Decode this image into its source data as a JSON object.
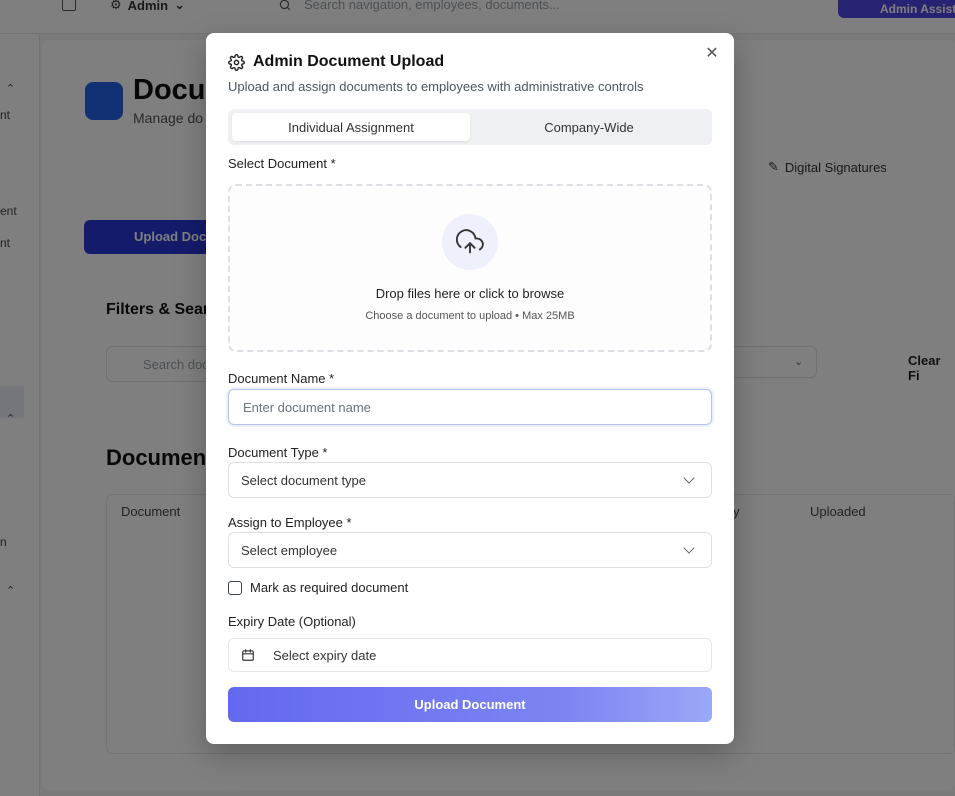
{
  "topbar": {
    "role": "Admin",
    "search_placeholder": "Search navigation, employees, documents...",
    "assistant_label": "Admin Assista"
  },
  "sidebar": {
    "fragments": [
      "nt",
      "ent",
      "nt",
      "n"
    ]
  },
  "page": {
    "title": "Docu",
    "subtitle": "Manage do",
    "digital_signatures": "Digital Signatures",
    "upload_button": "Upload Docu",
    "filters_title": "Filters & Searc",
    "search_placeholder": "Search doc",
    "clear_filters": "Clear Fi",
    "documents_title": "Document",
    "table_headers": {
      "document": "Document",
      "partial": "y",
      "uploaded": "Uploaded"
    }
  },
  "modal": {
    "title": "Admin Document Upload",
    "subtitle": "Upload and assign documents to employees with administrative controls",
    "tabs": [
      "Individual Assignment",
      "Company-Wide"
    ],
    "select_document_label": "Select Document *",
    "drop_title": "Drop files here or click to browse",
    "drop_subtitle": "Choose a document to upload • Max 25MB",
    "document_name_label": "Document Name *",
    "document_name_placeholder": "Enter document name",
    "document_type_label": "Document Type *",
    "document_type_value": "Select document type",
    "assign_label": "Assign to Employee *",
    "assign_value": "Select employee",
    "required_checkbox_label": "Mark as required document",
    "expiry_label": "Expiry Date (Optional)",
    "expiry_placeholder": "Select expiry date",
    "submit_label": "Upload Document"
  }
}
